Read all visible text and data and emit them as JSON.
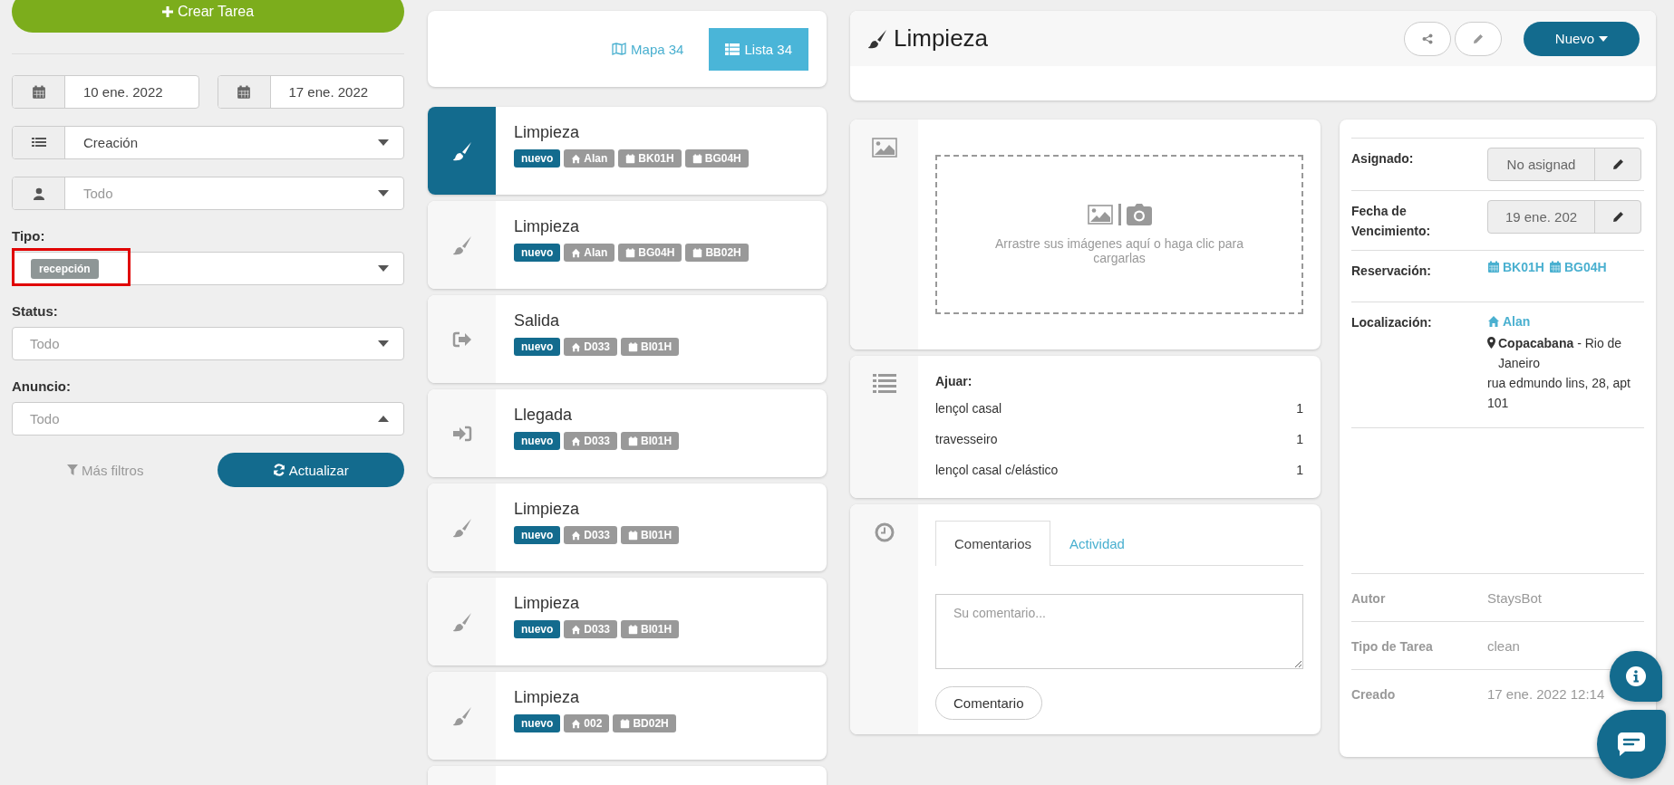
{
  "sidebar": {
    "create_button": "Crear Tarea",
    "date_from": "10 ene. 2022",
    "date_to": "17 ene. 2022",
    "order_select": {
      "value": "Creación",
      "open": false
    },
    "user_select": {
      "placeholder": "Todo",
      "open": false
    },
    "fields": [
      {
        "label": "Tipo:",
        "chips": [
          "recepción"
        ],
        "highlighted": true,
        "open": false
      },
      {
        "label": "Status:",
        "placeholder": "Todo",
        "open": false
      },
      {
        "label": "Anuncio:",
        "placeholder": "Todo",
        "open": true
      }
    ],
    "more_filters": "Más filtros",
    "refresh_button": "Actualizar"
  },
  "view_toggle": [
    {
      "label": "Mapa 34",
      "kind": "map",
      "selected": false
    },
    {
      "label": "Lista 34",
      "kind": "list",
      "selected": true
    }
  ],
  "tasks": [
    {
      "title": "Limpieza",
      "kind": "clean",
      "selected": true,
      "tags": [
        {
          "kind": "status",
          "text": "nuevo"
        },
        {
          "kind": "home",
          "text": "Alan"
        },
        {
          "kind": "calendar",
          "text": "BK01H"
        },
        {
          "kind": "calendar",
          "text": "BG04H"
        }
      ]
    },
    {
      "title": "Limpieza",
      "kind": "clean",
      "selected": false,
      "tags": [
        {
          "kind": "status",
          "text": "nuevo"
        },
        {
          "kind": "home",
          "text": "Alan"
        },
        {
          "kind": "calendar",
          "text": "BG04H"
        },
        {
          "kind": "calendar",
          "text": "BB02H"
        }
      ]
    },
    {
      "title": "Salida",
      "kind": "exit",
      "selected": false,
      "tags": [
        {
          "kind": "status",
          "text": "nuevo"
        },
        {
          "kind": "home",
          "text": "D033"
        },
        {
          "kind": "calendar",
          "text": "BI01H"
        }
      ]
    },
    {
      "title": "Llegada",
      "kind": "enter",
      "selected": false,
      "tags": [
        {
          "kind": "status",
          "text": "nuevo"
        },
        {
          "kind": "home",
          "text": "D033"
        },
        {
          "kind": "calendar",
          "text": "BI01H"
        }
      ]
    },
    {
      "title": "Limpieza",
      "kind": "clean",
      "selected": false,
      "tags": [
        {
          "kind": "status",
          "text": "nuevo"
        },
        {
          "kind": "home",
          "text": "D033"
        },
        {
          "kind": "calendar",
          "text": "BI01H"
        }
      ]
    },
    {
      "title": "Limpieza",
      "kind": "clean",
      "selected": false,
      "tags": [
        {
          "kind": "status",
          "text": "nuevo"
        },
        {
          "kind": "home",
          "text": "D033"
        },
        {
          "kind": "calendar",
          "text": "BI01H"
        }
      ]
    },
    {
      "title": "Limpieza",
      "kind": "clean",
      "selected": false,
      "tags": [
        {
          "kind": "status",
          "text": "nuevo"
        },
        {
          "kind": "home",
          "text": "002"
        },
        {
          "kind": "calendar",
          "text": "BD02H"
        }
      ]
    }
  ],
  "detail": {
    "title": "Limpieza",
    "new_button": "Nuevo",
    "upload_hint": "Arrastre sus imágenes aquí o haga clic para cargarlas",
    "ajuar": {
      "heading": "Ajuar:",
      "items": [
        {
          "name": "lençol casal",
          "qty": "1"
        },
        {
          "name": "travesseiro",
          "qty": "1"
        },
        {
          "name": "lençol casal c/elástico",
          "qty": "1"
        }
      ]
    },
    "tabs": [
      {
        "label": "Comentarios",
        "selected": true
      },
      {
        "label": "Actividad",
        "selected": false
      }
    ],
    "comment_placeholder": "Su comentario...",
    "comment_button": "Comentario"
  },
  "info": {
    "assigned": {
      "label": "Asignado:",
      "value": "No asignad"
    },
    "due": {
      "label": "Fecha de Vencimiento:",
      "value": "19 ene. 202"
    },
    "reservation": {
      "label": "Reservación:",
      "links": [
        "BK01H",
        "BG04H"
      ]
    },
    "location": {
      "label": "Localización:",
      "home": "Alan",
      "place": "**Copacabana** - Rio de Janeiro",
      "address": "rua edmundo lins, 28, apt 101"
    },
    "meta": [
      {
        "label": "Autor",
        "value": "StaysBot"
      },
      {
        "label": "Tipo de Tarea",
        "value": "clean"
      },
      {
        "label": "Creado",
        "value": "17 ene. 2022 12:14"
      }
    ]
  }
}
